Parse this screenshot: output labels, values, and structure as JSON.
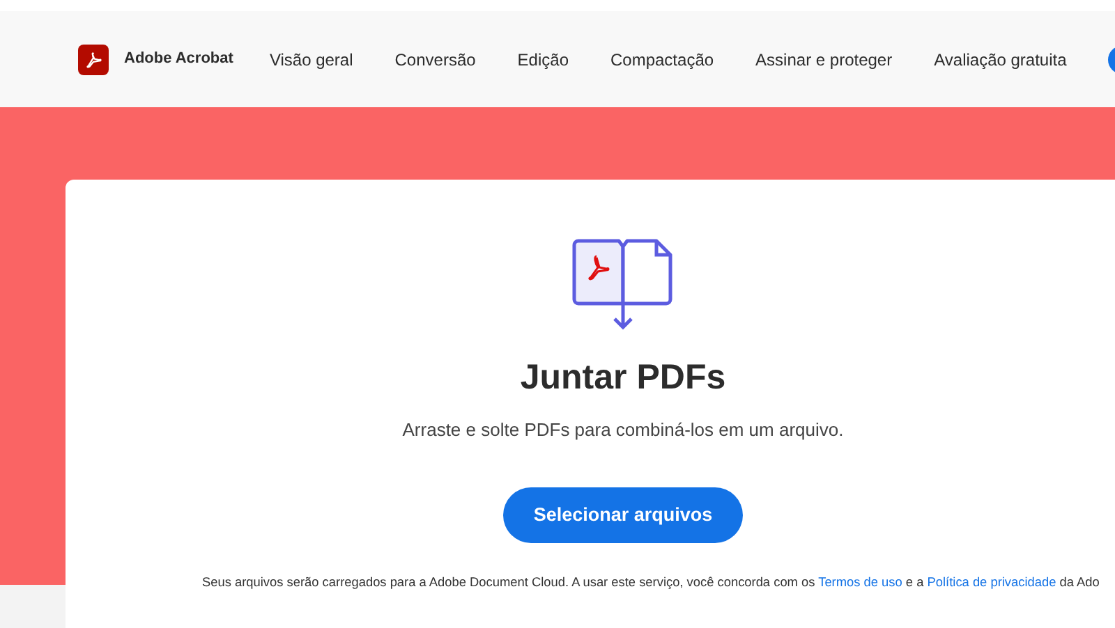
{
  "header": {
    "brand": "Adobe Acrobat",
    "nav": [
      {
        "label": "Visão geral"
      },
      {
        "label": "Conversão"
      },
      {
        "label": "Edição"
      },
      {
        "label": "Compactação"
      },
      {
        "label": "Assinar e proteger"
      },
      {
        "label": "Avaliação gratuita"
      }
    ]
  },
  "tool": {
    "title": "Juntar PDFs",
    "subtitle": "Arraste e solte PDFs para combiná-los em um arquivo.",
    "button": "Selecionar arquivos",
    "disclaimer": [
      {
        "kind": "text",
        "text": "Seus arquivos serão carregados para a Adobe Document Cloud.  A usar este serviço, você concorda com os "
      },
      {
        "kind": "link",
        "text": "Termos de uso"
      },
      {
        "kind": "text",
        "text": " e a "
      },
      {
        "kind": "link",
        "text": "Política de privacidade"
      },
      {
        "kind": "text",
        "text": " da Ado"
      }
    ]
  }
}
